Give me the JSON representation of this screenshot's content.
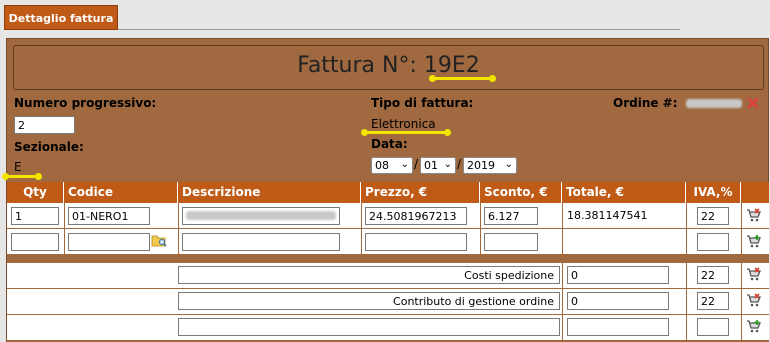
{
  "tab": {
    "label": "Dettaglio fattura"
  },
  "header": {
    "title_prefix": "Fattura N°: ",
    "number": "19E2"
  },
  "fields": {
    "numero_label": "Numero progressivo:",
    "numero_value": "2",
    "sezionale_label": "Sezionale:",
    "sezionale_value": "E",
    "tipo_label": "Tipo di fattura:",
    "tipo_value": "Elettronica",
    "data_label": "Data:",
    "day": "08",
    "month": "01",
    "year": "2019",
    "ordine_label": "Ordine #:"
  },
  "table": {
    "columns": [
      "Qty",
      "Codice",
      "Descrizione",
      "Prezzo, €",
      "Sconto, €",
      "Totale, €",
      "IVA,%"
    ],
    "rows": [
      {
        "qty": "1",
        "codice": "01-NERO1",
        "descrizione": "",
        "prezzo": "24.5081967213",
        "sconto": "6.127",
        "totale": "18.381147541",
        "iva": "22"
      },
      {
        "qty": "",
        "codice": "",
        "descrizione": "",
        "prezzo": "",
        "sconto": "",
        "totale": "",
        "iva": ""
      }
    ],
    "extra_rows": [
      {
        "label": "Costi spedizione",
        "value": "0",
        "iva": "22"
      },
      {
        "label": "Contributo di gestione ordine",
        "value": "0",
        "iva": "22"
      },
      {
        "label": "",
        "value": "",
        "iva": ""
      }
    ]
  },
  "icons": {
    "cart": "cart-icon",
    "folder": "folder-search-icon",
    "delete": "delete-x-icon"
  },
  "colors": {
    "tab": "#bf5b17",
    "panel": "#a0693f",
    "highlight": "#f2e600"
  }
}
